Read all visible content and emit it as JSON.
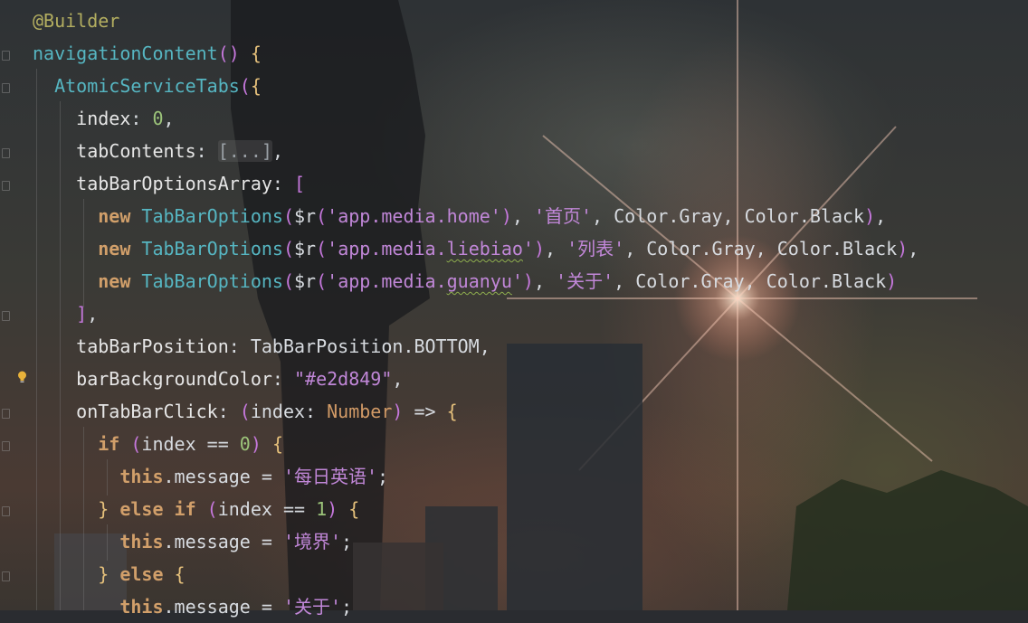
{
  "editor": {
    "lines": [
      {
        "tokens": [
          {
            "t": "@Builder",
            "c": "an"
          }
        ]
      },
      {
        "tokens": [
          {
            "t": "navigationContent",
            "c": "fn"
          },
          {
            "t": "() ",
            "c": "b2"
          },
          {
            "t": "{",
            "c": "b1"
          }
        ]
      },
      {
        "tokens": [
          {
            "t": "  AtomicServiceTabs",
            "c": "fn"
          },
          {
            "t": "(",
            "c": "b2"
          },
          {
            "t": "{",
            "c": "b1"
          }
        ]
      },
      {
        "tokens": [
          {
            "t": "    index",
            "c": "pr"
          },
          {
            "t": ": "
          },
          {
            "t": "0",
            "c": "nm"
          },
          {
            "t": ","
          }
        ]
      },
      {
        "tokens": [
          {
            "t": "    tabContents",
            "c": "pr"
          },
          {
            "t": ": "
          },
          {
            "t": "[...]",
            "c": "fold-text"
          },
          {
            "t": ","
          }
        ]
      },
      {
        "tokens": [
          {
            "t": "    tabBarOptionsArray",
            "c": "pr"
          },
          {
            "t": ": "
          },
          {
            "t": "[",
            "c": "b2"
          }
        ]
      },
      {
        "tokens": [
          {
            "t": "      new ",
            "c": "k"
          },
          {
            "t": "TabBarOptions",
            "c": "fn"
          },
          {
            "t": "(",
            "c": "b2"
          },
          {
            "t": "$r"
          },
          {
            "t": "(",
            "c": "b2"
          },
          {
            "t": "'app.media.home'",
            "c": "st"
          },
          {
            "t": ")",
            "c": "b2"
          },
          {
            "t": ", "
          },
          {
            "t": "'首页'",
            "c": "st"
          },
          {
            "t": ", Color.Gray, Color.Black"
          },
          {
            "t": ")",
            "c": "b2"
          },
          {
            "t": ","
          }
        ]
      },
      {
        "tokens": [
          {
            "t": "      new ",
            "c": "k"
          },
          {
            "t": "TabBarOptions",
            "c": "fn"
          },
          {
            "t": "(",
            "c": "b2"
          },
          {
            "t": "$r"
          },
          {
            "t": "(",
            "c": "b2"
          },
          {
            "t": "'app.media.",
            "c": "st"
          },
          {
            "t": "liebiao",
            "c": "st squig"
          },
          {
            "t": "'",
            "c": "st"
          },
          {
            "t": ")",
            "c": "b2"
          },
          {
            "t": ", "
          },
          {
            "t": "'列表'",
            "c": "st"
          },
          {
            "t": ", Color.Gray, Color.Black"
          },
          {
            "t": ")",
            "c": "b2"
          },
          {
            "t": ","
          }
        ]
      },
      {
        "tokens": [
          {
            "t": "      new ",
            "c": "k"
          },
          {
            "t": "TabBarOptions",
            "c": "fn"
          },
          {
            "t": "(",
            "c": "b2"
          },
          {
            "t": "$r"
          },
          {
            "t": "(",
            "c": "b2"
          },
          {
            "t": "'app.media.",
            "c": "st"
          },
          {
            "t": "guanyu",
            "c": "st squig"
          },
          {
            "t": "'",
            "c": "st"
          },
          {
            "t": ")",
            "c": "b2"
          },
          {
            "t": ", "
          },
          {
            "t": "'关于'",
            "c": "st"
          },
          {
            "t": ", Color.Gray, Color.Black"
          },
          {
            "t": ")",
            "c": "b2"
          }
        ]
      },
      {
        "tokens": [
          {
            "t": "    ]",
            "c": "b2"
          },
          {
            "t": ","
          }
        ]
      },
      {
        "tokens": [
          {
            "t": "    tabBarPosition",
            "c": "pr"
          },
          {
            "t": ": TabBarPosition.BOTTOM,"
          }
        ]
      },
      {
        "tokens": [
          {
            "t": "    barBackgroundColor",
            "c": "pr"
          },
          {
            "t": ": "
          },
          {
            "t": "\"#e2d849\"",
            "c": "st"
          },
          {
            "t": ","
          }
        ]
      },
      {
        "tokens": [
          {
            "t": "    onTabBarClick",
            "c": "pr"
          },
          {
            "t": ": "
          },
          {
            "t": "(",
            "c": "b2"
          },
          {
            "t": "index: "
          },
          {
            "t": "Number",
            "c": "ty"
          },
          {
            "t": ")",
            "c": "b2"
          },
          {
            "t": " => "
          },
          {
            "t": "{",
            "c": "b1"
          }
        ]
      },
      {
        "tokens": [
          {
            "t": "      if ",
            "c": "k"
          },
          {
            "t": "(",
            "c": "b2"
          },
          {
            "t": "index == "
          },
          {
            "t": "0",
            "c": "nm"
          },
          {
            "t": ")",
            "c": "b2"
          },
          {
            "t": " "
          },
          {
            "t": "{",
            "c": "b1"
          }
        ]
      },
      {
        "tokens": [
          {
            "t": "        this",
            "c": "k"
          },
          {
            "t": ".message = "
          },
          {
            "t": "'每日英语'",
            "c": "st"
          },
          {
            "t": ";"
          }
        ]
      },
      {
        "tokens": [
          {
            "t": "      } ",
            "c": "b1"
          },
          {
            "t": "else if ",
            "c": "k"
          },
          {
            "t": "(",
            "c": "b2"
          },
          {
            "t": "index == "
          },
          {
            "t": "1",
            "c": "nm"
          },
          {
            "t": ")",
            "c": "b2"
          },
          {
            "t": " "
          },
          {
            "t": "{",
            "c": "b1"
          }
        ]
      },
      {
        "tokens": [
          {
            "t": "        this",
            "c": "k"
          },
          {
            "t": ".message = "
          },
          {
            "t": "'境界'",
            "c": "st"
          },
          {
            "t": ";"
          }
        ]
      },
      {
        "tokens": [
          {
            "t": "      } ",
            "c": "b1"
          },
          {
            "t": "else ",
            "c": "k"
          },
          {
            "t": "{",
            "c": "b1"
          }
        ]
      },
      {
        "tokens": [
          {
            "t": "        this",
            "c": "k"
          },
          {
            "t": ".message = "
          },
          {
            "t": "'关于'",
            "c": "st"
          },
          {
            "t": ";"
          }
        ]
      }
    ]
  },
  "gutter": {
    "intention_icon": "lightbulb-icon"
  }
}
